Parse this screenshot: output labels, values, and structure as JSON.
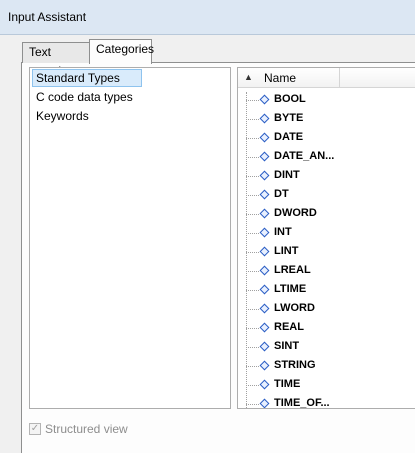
{
  "window": {
    "title": "Input Assistant"
  },
  "tabs": [
    {
      "label": "Text search",
      "selected": false
    },
    {
      "label": "Categories",
      "selected": true
    }
  ],
  "categories": [
    {
      "label": "Standard Types",
      "selected": true
    },
    {
      "label": "C code data types",
      "selected": false
    },
    {
      "label": "Keywords",
      "selected": false
    }
  ],
  "types_list": {
    "column_header": "Name",
    "sort_icon": "sort-ascending-icon",
    "item_icon": "blue-diamond-icon",
    "items": [
      "BOOL",
      "BYTE",
      "DATE",
      "DATE_AN...",
      "DINT",
      "DT",
      "DWORD",
      "INT",
      "LINT",
      "LREAL",
      "LTIME",
      "LWORD",
      "REAL",
      "SINT",
      "STRING",
      "TIME",
      "TIME_OF..."
    ]
  },
  "structured_view": {
    "label": "Structured view",
    "checked": true,
    "enabled": false
  },
  "colors": {
    "titlebar": "#dce7f3",
    "selection": "#d9ebfb",
    "icon_blue": "#2a5dc4"
  }
}
